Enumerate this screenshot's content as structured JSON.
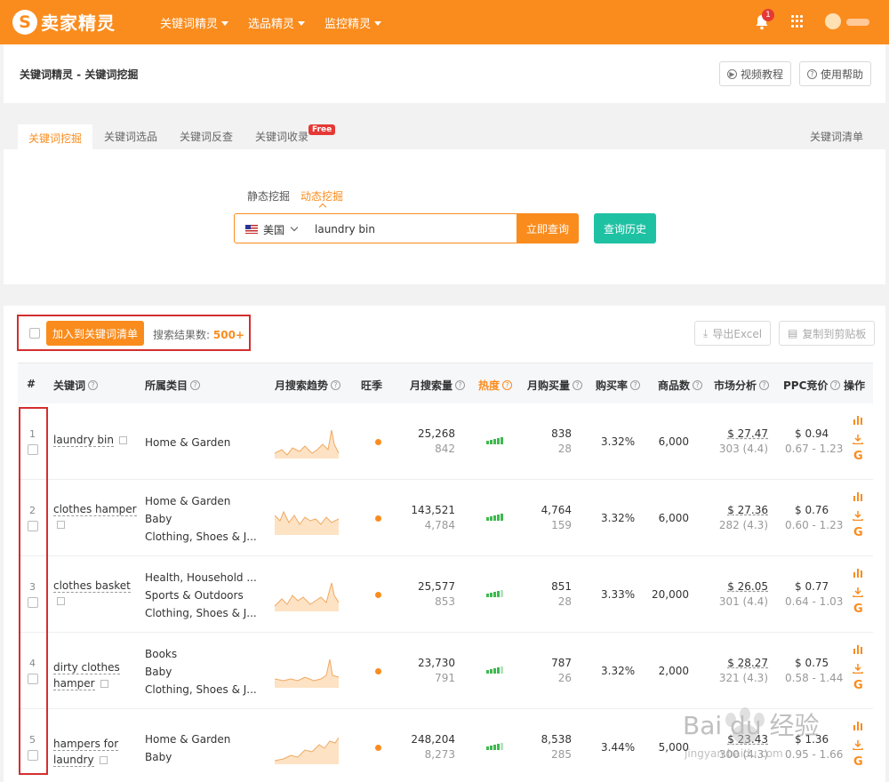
{
  "app": {
    "logo_text": "卖家精灵",
    "logo_letter": "S"
  },
  "topnav": [
    "关键词精灵",
    "选品精灵",
    "监控精灵"
  ],
  "notifications": {
    "count": "1"
  },
  "breadcrumb": "关键词精灵 - 关键词挖掘",
  "header_buttons": {
    "video": "视频教程",
    "help": "使用帮助"
  },
  "tabs": [
    {
      "label": "关键词挖掘",
      "active": true
    },
    {
      "label": "关键词选品"
    },
    {
      "label": "关键词反查"
    },
    {
      "label": "关键词收录"
    },
    {
      "label": "关键词清单"
    }
  ],
  "free_badge": "Free",
  "mode_tabs": {
    "static": "静态挖掘",
    "dynamic": "动态挖掘"
  },
  "search": {
    "country": "美国",
    "keyword": "laundry bin",
    "query_label": "立即查询",
    "history_label": "查询历史"
  },
  "results_bar": {
    "add_label": "加入到关键词清单",
    "count_label": "搜索结果数:",
    "count_value": "500+",
    "export_label": "导出Excel",
    "copy_label": "复制到剪贴板"
  },
  "table": {
    "headers": [
      "#",
      "关键词",
      "所属类目",
      "月搜索趋势",
      "旺季",
      "月搜索量",
      "热度",
      "月购买量",
      "购买率",
      "商品数",
      "市场分析",
      "PPC竞价",
      "操作"
    ],
    "rows": [
      {
        "idx": "1",
        "kw1": "laundry bin",
        "kw2": "",
        "cats": [
          "Home & Garden"
        ],
        "search": "25,268",
        "search_sub": "842",
        "heat": 5,
        "buy": "838",
        "buy_sub": "28",
        "rate": "3.32%",
        "products": "6,000",
        "market": "$ 27.47",
        "market_sub": "303 (4.4)",
        "ppc": "$ 0.94",
        "ppc_sub": "0.67 - 1.23"
      },
      {
        "idx": "2",
        "kw1": "clothes hamper",
        "kw2": "",
        "cats": [
          "Home & Garden",
          "Baby",
          "Clothing, Shoes & J..."
        ],
        "search": "143,521",
        "search_sub": "4,784",
        "heat": 5,
        "buy": "4,764",
        "buy_sub": "159",
        "rate": "3.32%",
        "products": "6,000",
        "market": "$ 27.36",
        "market_sub": "282 (4.3)",
        "ppc": "$ 0.76",
        "ppc_sub": "0.60 - 1.23"
      },
      {
        "idx": "3",
        "kw1": "clothes basket",
        "kw2": "",
        "cats": [
          "Health, Household ...",
          "Sports & Outdoors",
          "Clothing, Shoes & J..."
        ],
        "search": "25,577",
        "search_sub": "853",
        "heat": 4,
        "buy": "851",
        "buy_sub": "28",
        "rate": "3.33%",
        "products": "20,000",
        "market": "$ 26.05",
        "market_sub": "301 (4.4)",
        "ppc": "$ 0.77",
        "ppc_sub": "0.64 - 1.03"
      },
      {
        "idx": "4",
        "kw1": "dirty clothes",
        "kw2": "hamper",
        "cats": [
          "Books",
          "Baby",
          "Clothing, Shoes & J..."
        ],
        "search": "23,730",
        "search_sub": "791",
        "heat": 4,
        "buy": "787",
        "buy_sub": "26",
        "rate": "3.32%",
        "products": "2,000",
        "market": "$ 28.27",
        "market_sub": "321 (4.3)",
        "ppc": "$ 0.75",
        "ppc_sub": "0.58 - 1.44"
      },
      {
        "idx": "5",
        "kw1": "hampers for",
        "kw2": "laundry",
        "cats": [
          "Home & Garden",
          "Baby"
        ],
        "search": "248,204",
        "search_sub": "8,273",
        "heat": 4,
        "buy": "8,538",
        "buy_sub": "285",
        "rate": "3.44%",
        "products": "5,000",
        "market": "$ 23.43",
        "market_sub": "300 (4.3)",
        "ppc": "$ 1.36",
        "ppc_sub": "0.95 - 1.66"
      }
    ]
  },
  "watermark": {
    "text": "Bai du 经验",
    "url": "jingyan.baidu.com"
  },
  "colors": {
    "brand": "#fa8c1e",
    "teal": "#1fc1a3",
    "highlight": "#d32f2f"
  }
}
